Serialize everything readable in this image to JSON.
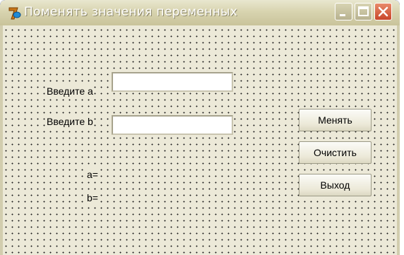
{
  "window": {
    "title": "Поменять значения переменных"
  },
  "form": {
    "label_a": "Введите а",
    "label_b": "Введите b",
    "input_a_value": "",
    "input_b_value": "",
    "result_a_label": "a=",
    "result_b_label": "b="
  },
  "buttons": {
    "swap": "Менять",
    "clear": "Очистить",
    "exit": "Выход"
  },
  "icons": {
    "app": "delphi-app-icon",
    "minimize": "minimize-icon",
    "maximize": "maximize-icon",
    "close": "close-icon"
  },
  "colors": {
    "titlebar": "#d8d4b0",
    "client_background": "#ece9d8",
    "close_button": "#d0563a"
  }
}
